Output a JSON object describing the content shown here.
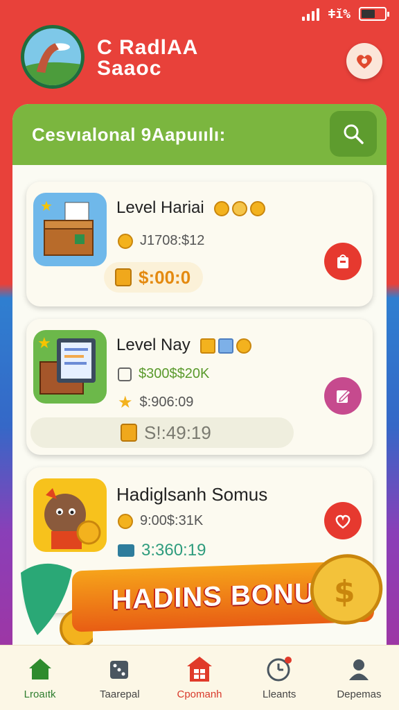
{
  "status": {
    "network_text": "ǂĭ%",
    "signal_bars": 4
  },
  "header": {
    "title_line1": "C RadlAA",
    "title_line2": "Saaoc"
  },
  "panel": {
    "title": "Cesvıalonal 9Aapuıılı:"
  },
  "cards": [
    {
      "title": "Level Hariai",
      "meta": "J1708:$12",
      "price": "$:00:0"
    },
    {
      "title": "Level Nay",
      "meta": "$300$$20K",
      "meta2": "$:906:09",
      "price": "S!:49:19"
    },
    {
      "title": "Hadiglsanh Somus",
      "meta": "9:00$:31K",
      "meta2": "3:360:19"
    }
  ],
  "banner": {
    "text": "HADINS BONUS"
  },
  "nav": [
    {
      "label": "Lroaıtk",
      "icon": "home-icon"
    },
    {
      "label": "Taarepal",
      "icon": "dice-icon"
    },
    {
      "label": "Cpomanh",
      "icon": "shop-icon"
    },
    {
      "label": "Lleants",
      "icon": "clock-icon"
    },
    {
      "label": "Depemas",
      "icon": "profile-icon"
    }
  ],
  "colors": {
    "primary_red": "#e8413a",
    "green": "#7bb63f",
    "accent_orange": "#f6a31a"
  }
}
